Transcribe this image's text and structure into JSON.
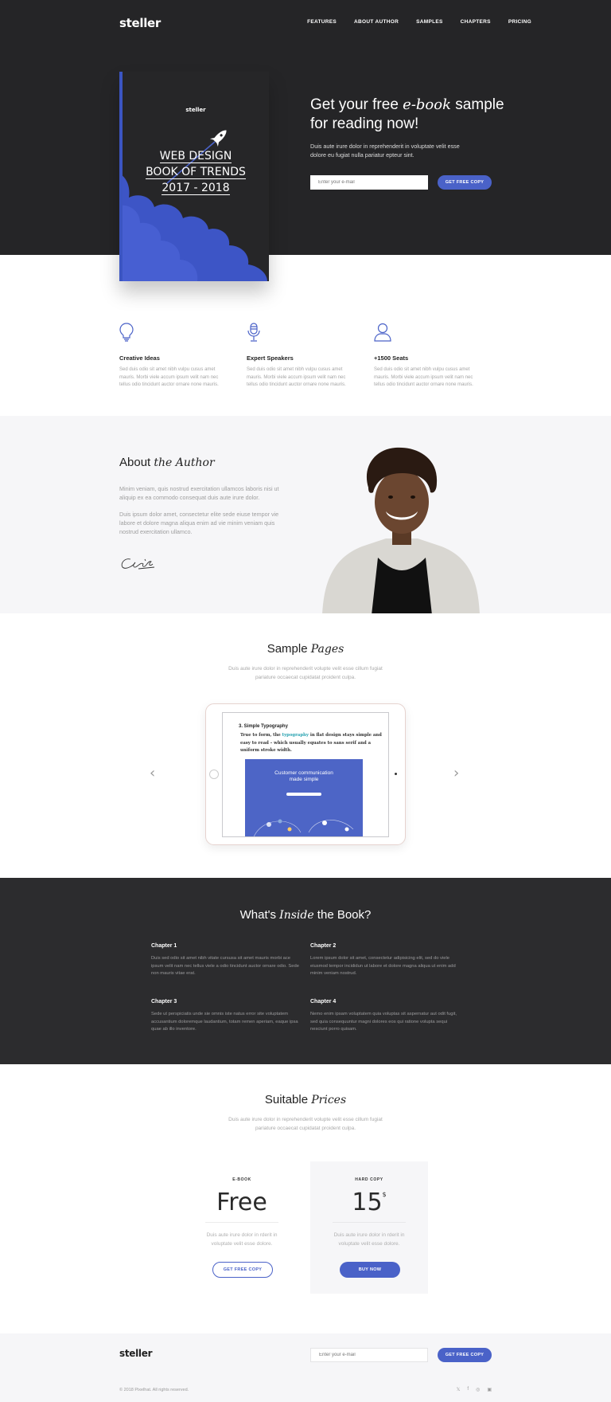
{
  "brand": "steller",
  "nav": [
    "FEATURES",
    "ABOUT AUTHOR",
    "SAMPLES",
    "CHAPTERS",
    "PRICING"
  ],
  "book": {
    "logo": "steller",
    "title1": "WEB DESIGN",
    "title2": "BOOK OF TRENDS",
    "title3": "2017 - 2018"
  },
  "hero": {
    "title_pre": "Get your free ",
    "title_em": "e-book",
    "title_post": " sample for reading now!",
    "text": "Duis aute irure dolor in reprehenderit in voluptate velit esse dolore eu fugiat nulla pariatur epteur sint.",
    "email_placeholder": "Enter your e-mail",
    "cta": "GET FREE COPY"
  },
  "features": [
    {
      "icon": "lightbulb-icon",
      "title": "Creative Ideas",
      "text": "Sed duis odio sit amet nibh vulpu cusus amet mauris. Morbi viele accum ipsum velit nam nec tellus odio tincidunt auctor ornare none mauris."
    },
    {
      "icon": "microphone-icon",
      "title": "Expert Speakers",
      "text": "Sed duis odio sit amet nibh vulpu cusus amet mauris. Morbi viele accum ipsum velit nam nec tellus odio tincidunt auctor ornare none mauris."
    },
    {
      "icon": "user-icon",
      "title": "+1500 Seats",
      "text": "Sed duis odio sit amet nibh vulpu cusus amet mauris. Morbi viele accum ipsum velit nam nec tellus odio tincidunt auctor ornare none mauris."
    }
  ],
  "about": {
    "title": "About ",
    "title_em": "the Author",
    "p1": "Minim veniam, quis nostrud exercitation ullamcos laboris nisi ut aliquip ex ea commodo consequat duis aute irure dolor.",
    "p2": "Duis ipsum dolor amet, consectetur elite sede eiuse tempor vie labore et dolore magna aliqua enim ad vie minim veniam quis nostrud exercitation ullamco."
  },
  "samples": {
    "title": "Sample ",
    "title_em": "Pages",
    "text": "Duis aute irure dolor in reprehenderit volupte velit esse cillum fugiat pariature occaecat cupidatat proident culpa.",
    "doc_title": "3.  Simple Typography",
    "doc_pre": "True to form, the ",
    "doc_link": "typography",
    "doc_post": " in flat design stays simple and easy to read – which usually equates to sans serif and a uniform stroke width.",
    "mock_heading1": "Customer communication",
    "mock_heading2": "made simple",
    "prev": "‹",
    "next": "›"
  },
  "inside": {
    "title_pre": "What's ",
    "title_em": "Inside",
    "title_post": " the Book?",
    "chapters": [
      {
        "title": "Chapter 1",
        "text": "Duis sed odio sit amet nibh vitate cursusa sit amet mauris morbi ace ipsum velit nam nec tellus viele a odio tincidunt auctor ornare odio. Sede non mauris vitae erat."
      },
      {
        "title": "Chapter 2",
        "text": "Lorem ipsum dolor sit amet, consectetur adipisicing elit, sed do viele eiusmod tempor incididun ut labore et dolore magna aliqua ut enim add minim veniam nostrud."
      },
      {
        "title": "Chapter 3",
        "text": "Sede ut perspiciatis unde sie omnis iste natus error site voluptatem accusantium doloremque laudantium, totam remen aperiam, eaque ipsa quae ab illo inventore."
      },
      {
        "title": "Chapter 4",
        "text": "Nemo enim ipsam voluptatem quia voluptas sit aspernatur aut odit fugit, sed quia consequuntur magni dolores eos qui ratione volupta sequi nesciunt porro quisam."
      }
    ]
  },
  "prices": {
    "title": "Suitable ",
    "title_em": "Prices",
    "text": "Duis aute irure dolor in reprehenderit volupte velit esse cillum fugiat pariature occaecat cupidatat proident culpa.",
    "plans": [
      {
        "label": "E-BOOK",
        "price": "Free",
        "currency": "",
        "text": "Duis aute irure dolor in rderit in voluptate velit esse dolore.",
        "button": "GET FREE COPY"
      },
      {
        "label": "HARD COPY",
        "price": "15",
        "currency": "$",
        "text": "Duis aute irure dolor in rderit in voluptate velit esse dolore.",
        "button": "BUY NOW"
      }
    ]
  },
  "footer": {
    "brand": "steller",
    "email_placeholder": "Enter your e-mail",
    "cta": "GET FREE COPY",
    "copyright": "© 2018 Pixelhat. All rights reserved.",
    "social": [
      "twitter-icon",
      "facebook-icon",
      "dribbble-icon",
      "instagram-icon"
    ]
  },
  "colors": {
    "accent": "#4a62c8",
    "dark": "#252527",
    "light": "#f6f6f8"
  }
}
